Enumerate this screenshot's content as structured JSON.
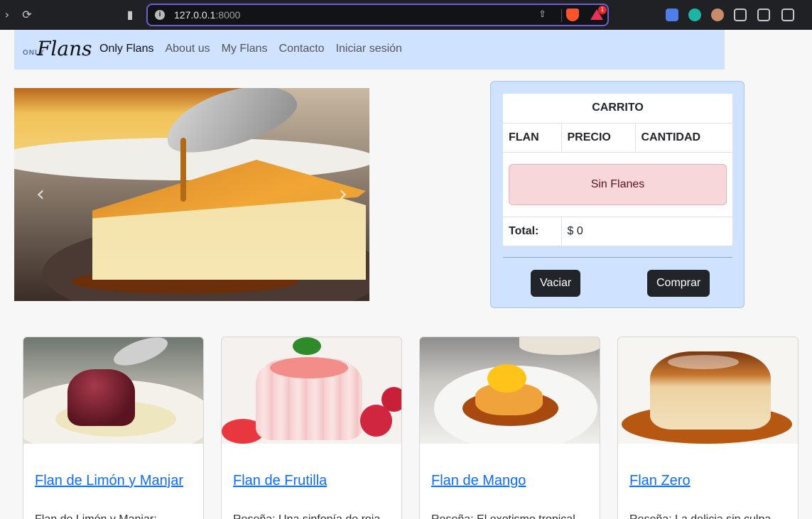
{
  "browser": {
    "url_host": "127.0.0.1",
    "url_port": ":8000",
    "rewards_badge": "1"
  },
  "navbar": {
    "logo_small": "ONLY",
    "logo_big": "Flans",
    "links": [
      "Only Flans",
      "About us",
      "My Flans",
      "Contacto",
      "Iniciar sesión"
    ]
  },
  "carousel": {
    "prev_label": "‹",
    "next_label": "›"
  },
  "cart": {
    "title": "CARRITO",
    "columns": [
      "FLAN",
      "PRECIO",
      "CANTIDAD"
    ],
    "empty_message": "Sin Flanes",
    "total_label": "Total:",
    "total_value": "$ 0",
    "empty_button": "Vaciar",
    "buy_button": "Comprar"
  },
  "products": [
    {
      "name": "Flan de Limón y Manjar",
      "description": "Flan de Limón y Manjar:"
    },
    {
      "name": "Flan de Frutilla",
      "description": "Reseña: Una sinfonía de roja"
    },
    {
      "name": "Flan de Mango",
      "description": "Reseña: El exotismo tropical"
    },
    {
      "name": "Flan Zero",
      "description": "Reseña: La delicia sin culpa"
    }
  ],
  "colors": {
    "navbar_bg": "#cfe2ff",
    "link": "#0d6efd",
    "alert_bg": "#f8d7da",
    "button_dark": "#212529"
  }
}
